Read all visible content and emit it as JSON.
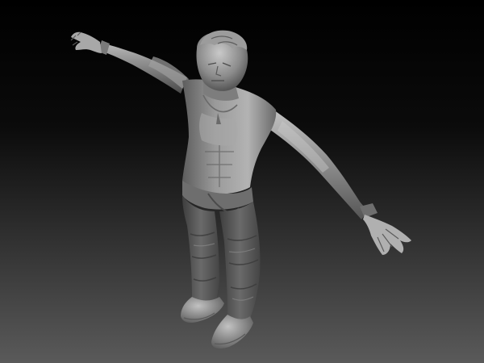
{
  "viewport": {
    "background_top": "#000000",
    "background_bottom": "#5a5a5a",
    "model_color": "#8c8c8c",
    "model_highlight": "#c4c4c4",
    "model_shadow": "#3a3a3a"
  }
}
